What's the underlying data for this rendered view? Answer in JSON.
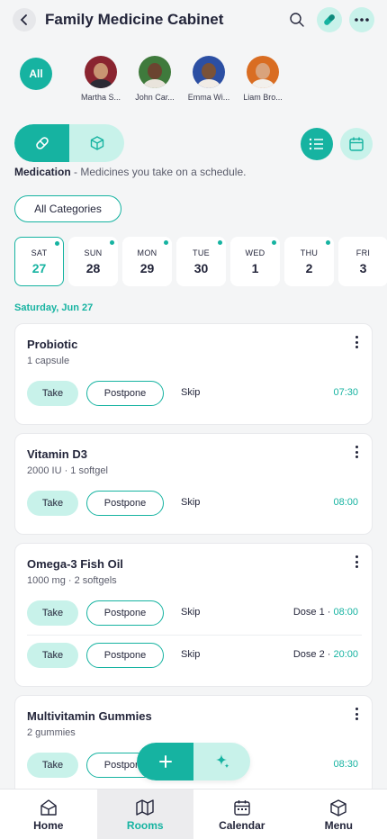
{
  "header": {
    "title": "Family Medicine Cabinet",
    "back_icon": "chevron-left-icon",
    "search_icon": "search-icon",
    "pill_icon": "pill-icon",
    "more_icon": "more-horizontal-icon"
  },
  "members": {
    "all_label": "All",
    "people": [
      {
        "name": "Martha S...",
        "color": "#8a2430"
      },
      {
        "name": "John Car...",
        "color": "#3f7a3c"
      },
      {
        "name": "Emma Wi...",
        "color": "#2c4fa3"
      },
      {
        "name": "Liam Bro...",
        "color": "#d96d22"
      }
    ]
  },
  "mode": {
    "title": "Medication",
    "description": " - Medicines you take on a schedule."
  },
  "filter": {
    "category_label": "All Categories"
  },
  "days": [
    {
      "dow": "SAT",
      "num": "27",
      "selected": true
    },
    {
      "dow": "SUN",
      "num": "28"
    },
    {
      "dow": "MON",
      "num": "29"
    },
    {
      "dow": "TUE",
      "num": "30"
    },
    {
      "dow": "WED",
      "num": "1"
    },
    {
      "dow": "THU",
      "num": "2"
    },
    {
      "dow": "FRI",
      "num": "3"
    }
  ],
  "date_heading": "Saturday, Jun 27",
  "actions": {
    "take": "Take",
    "postpone": "Postpone",
    "skip": "Skip"
  },
  "medications": [
    {
      "name": "Probiotic",
      "dose": "1 capsule",
      "doses": [
        {
          "label": "",
          "time": "07:30"
        }
      ]
    },
    {
      "name": "Vitamin D3",
      "dose": "2000 IU · 1 softgel",
      "doses": [
        {
          "label": "",
          "time": "08:00"
        }
      ]
    },
    {
      "name": "Omega-3 Fish Oil",
      "dose": "1000 mg · 2 softgels",
      "doses": [
        {
          "label": "Dose 1 · ",
          "time": "08:00"
        },
        {
          "label": "Dose 2 · ",
          "time": "20:00"
        }
      ]
    },
    {
      "name": "Multivitamin Gummies",
      "dose": "2 gummies",
      "doses": [
        {
          "label": "",
          "time": "08:30"
        }
      ]
    }
  ],
  "fab": {
    "add_icon": "plus-icon",
    "ai_icon": "sparkle-icon"
  },
  "tabs": [
    {
      "label": "Home",
      "icon": "home-icon"
    },
    {
      "label": "Rooms",
      "icon": "rooms-icon",
      "active": true
    },
    {
      "label": "Calendar",
      "icon": "calendar-icon"
    },
    {
      "label": "Menu",
      "icon": "menu-cube-icon"
    }
  ],
  "colors": {
    "accent": "#16b3a1",
    "accent_light": "#c8f2ea",
    "text": "#23253a"
  }
}
